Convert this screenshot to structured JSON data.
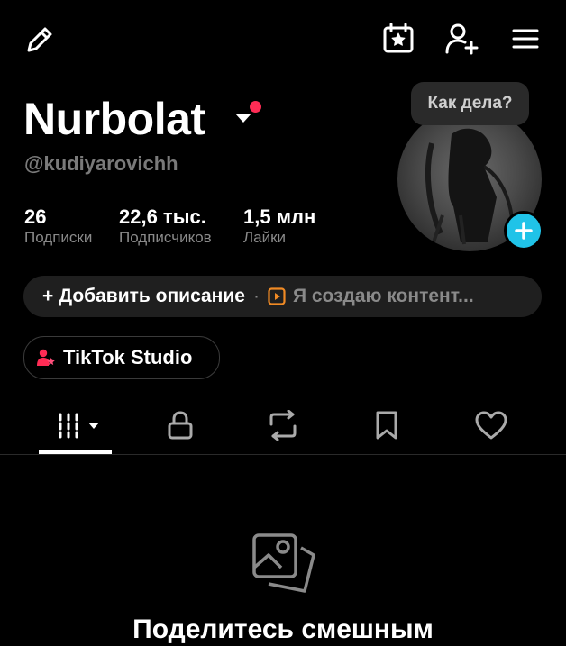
{
  "header": {
    "edit_icon": "pencil-icon",
    "calendar_icon": "calendar-star-icon",
    "add_friend_icon": "add-person-icon",
    "menu_icon": "hamburger-menu-icon"
  },
  "profile": {
    "name": "Nurbolat",
    "handle": "@kudiyarovichh",
    "status_bubble": "Как дела?",
    "notification_dot_color": "#ff2c55",
    "stats": [
      {
        "value": "26",
        "label": "Подписки"
      },
      {
        "value": "22,6 тыс.",
        "label": "Подписчиков"
      },
      {
        "value": "1,5 млн",
        "label": "Лайки"
      }
    ]
  },
  "description": {
    "add_label": "+ Добавить описание",
    "separator": "·",
    "creator_label": "Я создаю контент..."
  },
  "studio": {
    "label": "TikTok Studio"
  },
  "tabs": [
    {
      "name": "videos",
      "icon": "grid-icon",
      "active": true
    },
    {
      "name": "private",
      "icon": "lock-icon",
      "active": false
    },
    {
      "name": "reposts",
      "icon": "repost-icon",
      "active": false
    },
    {
      "name": "favorites",
      "icon": "bookmark-icon",
      "active": false
    },
    {
      "name": "liked",
      "icon": "heart-icon",
      "active": false
    }
  ],
  "empty_state": {
    "icon": "photos-icon",
    "title": "Поделитесь смешным"
  },
  "colors": {
    "accent": "#20c3e8",
    "background": "#000000",
    "secondary_text": "#8a8a8a"
  }
}
